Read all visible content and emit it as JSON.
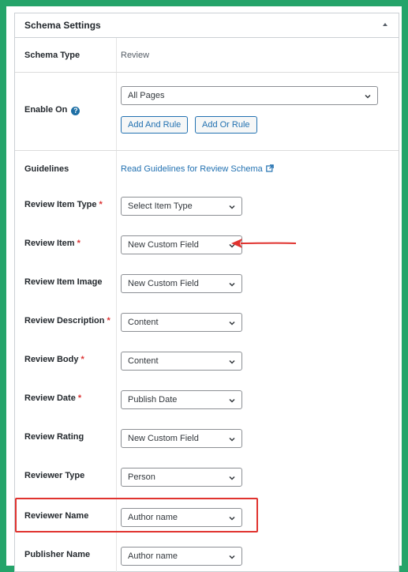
{
  "panel": {
    "title": "Schema Settings",
    "collapse_icon": "triangle-up-icon"
  },
  "rows": {
    "schema_type": {
      "label": "Schema Type",
      "value": "Review"
    },
    "enable_on": {
      "label": "Enable On",
      "help_icon": "question-circle-icon",
      "select_value": "All Pages",
      "add_and_rule": "Add And Rule",
      "add_or_rule": "Add Or Rule"
    },
    "guidelines": {
      "label": "Guidelines",
      "link_text": "Read Guidelines for Review Schema",
      "link_icon": "external-link-icon"
    },
    "review_item_type": {
      "label": "Review Item Type",
      "required": "*",
      "value": "Select Item Type"
    },
    "review_item": {
      "label": "Review Item",
      "required": "*",
      "value": "New Custom Field"
    },
    "review_item_image": {
      "label": "Review Item Image",
      "value": "New Custom Field"
    },
    "review_description": {
      "label": "Review Description",
      "required": "*",
      "value": "Content"
    },
    "review_body": {
      "label": "Review Body",
      "required": "*",
      "value": "Content"
    },
    "review_date": {
      "label": "Review Date",
      "required": "*",
      "value": "Publish Date"
    },
    "review_rating": {
      "label": "Review Rating",
      "value": "New Custom Field"
    },
    "reviewer_type": {
      "label": "Reviewer Type",
      "value": "Person"
    },
    "reviewer_name": {
      "label": "Reviewer Name",
      "value": "Author name"
    },
    "publisher_name": {
      "label": "Publisher Name",
      "value": "Author name"
    }
  },
  "annotations": {
    "arrow_color": "#e0332f",
    "highlight_color": "#e0332f",
    "frame_color": "#25a46a"
  }
}
